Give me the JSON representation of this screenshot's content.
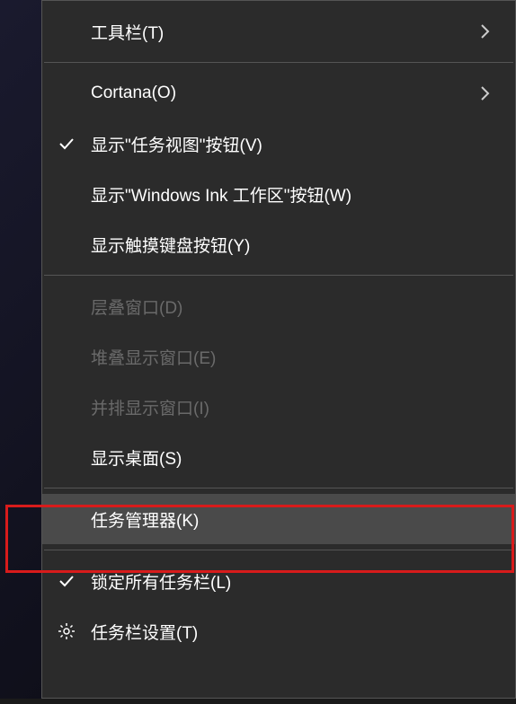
{
  "menu": {
    "items": [
      {
        "label": "工具栏(T)",
        "hasSubmenu": true,
        "checked": false,
        "icon": null,
        "disabled": false,
        "highlighted": false
      },
      {
        "separator": true
      },
      {
        "label": "Cortana(O)",
        "hasSubmenu": true,
        "checked": false,
        "icon": null,
        "disabled": false,
        "highlighted": false
      },
      {
        "label": "显示\"任务视图\"按钮(V)",
        "hasSubmenu": false,
        "checked": true,
        "icon": null,
        "disabled": false,
        "highlighted": false
      },
      {
        "label": "显示\"Windows Ink 工作区\"按钮(W)",
        "hasSubmenu": false,
        "checked": false,
        "icon": null,
        "disabled": false,
        "highlighted": false
      },
      {
        "label": "显示触摸键盘按钮(Y)",
        "hasSubmenu": false,
        "checked": false,
        "icon": null,
        "disabled": false,
        "highlighted": false
      },
      {
        "separator": true
      },
      {
        "label": "层叠窗口(D)",
        "hasSubmenu": false,
        "checked": false,
        "icon": null,
        "disabled": true,
        "highlighted": false
      },
      {
        "label": "堆叠显示窗口(E)",
        "hasSubmenu": false,
        "checked": false,
        "icon": null,
        "disabled": true,
        "highlighted": false
      },
      {
        "label": "并排显示窗口(I)",
        "hasSubmenu": false,
        "checked": false,
        "icon": null,
        "disabled": true,
        "highlighted": false
      },
      {
        "label": "显示桌面(S)",
        "hasSubmenu": false,
        "checked": false,
        "icon": null,
        "disabled": false,
        "highlighted": false
      },
      {
        "separator": true
      },
      {
        "label": "任务管理器(K)",
        "hasSubmenu": false,
        "checked": false,
        "icon": null,
        "disabled": false,
        "highlighted": true
      },
      {
        "separator": true
      },
      {
        "label": "锁定所有任务栏(L)",
        "hasSubmenu": false,
        "checked": true,
        "icon": null,
        "disabled": false,
        "highlighted": false
      },
      {
        "label": "任务栏设置(T)",
        "hasSubmenu": false,
        "checked": false,
        "icon": "gear",
        "disabled": false,
        "highlighted": false
      }
    ]
  }
}
